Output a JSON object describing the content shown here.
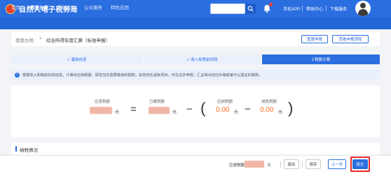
{
  "header": {
    "brand": "自然人电子税务局",
    "links": [
      "手机APP",
      "帮助中心",
      "下载服务"
    ]
  },
  "nav": {
    "items": [
      "首页",
      "我要办税",
      "我要查询",
      "公众服务",
      "特色应用"
    ],
    "active_index": 1
  },
  "breadcrumb": {
    "items": [
      "我要办税",
      ">",
      "综合所得年度汇算（标准申报）"
    ]
  },
  "actions": {
    "reset": "重置申报",
    "view_notice": "查看申报须知"
  },
  "steps": [
    {
      "label": "✓ 基础信息",
      "state": "done"
    },
    {
      "label": "✓ 收入和税前扣除",
      "state": "done"
    },
    {
      "label": "3 税款计算",
      "state": "active"
    }
  ],
  "notice": "根据收入和税前扣除信息，计算出应纳税额，即您当年需要缴纳的税款。如您存在减免项目，可在这步申报；汇总得出您应补缴或者可以退还的税款。",
  "formula": {
    "refund_label": "应退税额",
    "paid_label": "已缴税额",
    "payable_label": "应纳税额",
    "relief_label": "减免税额",
    "unit": "元",
    "payable_value": "0.00",
    "relief_value": "0.00",
    "equals": "=",
    "minus": "−",
    "lparen": "(",
    "rparen": ")"
  },
  "section": {
    "title": "纳税情况"
  },
  "footer": {
    "refund_label": "应退税额",
    "unit": "元",
    "exit": "退出",
    "save": "保存",
    "prev": "上一步",
    "submit": "提交"
  },
  "colors": {
    "primary": "#2b6ee0",
    "amount": "#ff6d1f",
    "highlight": "#e42b2b"
  }
}
